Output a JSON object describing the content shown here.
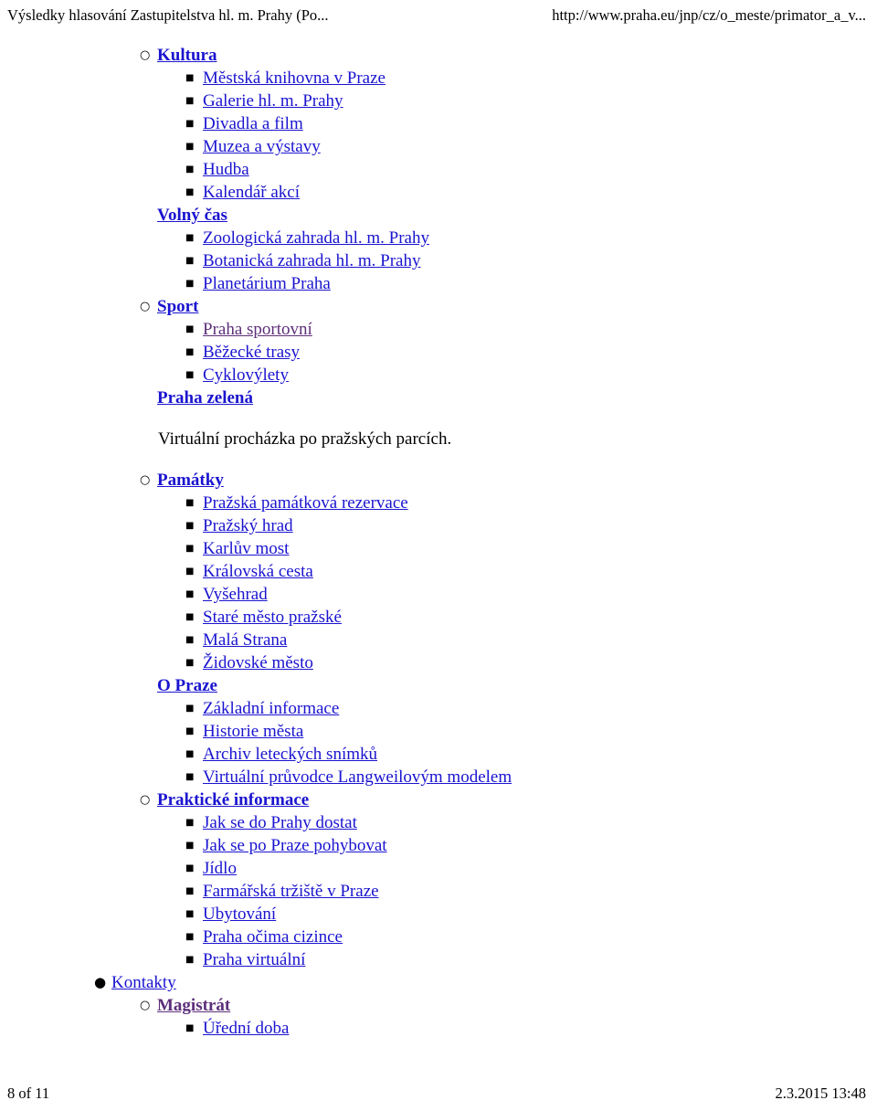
{
  "header": {
    "title": "Výsledky hlasování Zastupitelstva hl. m. Prahy (Po...",
    "url": "http://www.praha.eu/jnp/cz/o_meste/primator_a_v..."
  },
  "footer": {
    "page": "8 of 11",
    "timestamp": "2.3.2015 13:48"
  },
  "colors": {
    "link": "#1a14cf",
    "visited_link": "#5d2f7a",
    "text": "#000000",
    "background": "#ffffff"
  },
  "markers": {
    "disc": "●",
    "circle": "○",
    "square": "■"
  },
  "nav": {
    "items": [
      {
        "label": "Kultura",
        "level": 2,
        "marker": "circle",
        "bold": true,
        "link": true,
        "visited": false
      },
      {
        "label": "Městská knihovna v Praze",
        "level": 3,
        "marker": "square",
        "bold": false,
        "link": true,
        "visited": false
      },
      {
        "label": "Galerie hl. m. Prahy",
        "level": 3,
        "marker": "square",
        "bold": false,
        "link": true,
        "visited": false
      },
      {
        "label": "Divadla a film",
        "level": 3,
        "marker": "square",
        "bold": false,
        "link": true,
        "visited": false
      },
      {
        "label": "Muzea a výstavy",
        "level": 3,
        "marker": "square",
        "bold": false,
        "link": true,
        "visited": false
      },
      {
        "label": "Hudba",
        "level": 3,
        "marker": "square",
        "bold": false,
        "link": true,
        "visited": false
      },
      {
        "label": "Kalendář akcí",
        "level": 3,
        "marker": "square",
        "bold": false,
        "link": true,
        "visited": false
      },
      {
        "label": "Volný čas",
        "level": 2,
        "marker": "none",
        "bold": true,
        "link": true,
        "visited": false
      },
      {
        "label": "Zoologická zahrada hl. m. Prahy",
        "level": 3,
        "marker": "square",
        "bold": false,
        "link": true,
        "visited": false
      },
      {
        "label": "Botanická zahrada hl. m. Prahy",
        "level": 3,
        "marker": "square",
        "bold": false,
        "link": true,
        "visited": false
      },
      {
        "label": "Planetárium Praha",
        "level": 3,
        "marker": "square",
        "bold": false,
        "link": true,
        "visited": false
      },
      {
        "label": "Sport",
        "level": 2,
        "marker": "circle",
        "bold": true,
        "link": true,
        "visited": false
      },
      {
        "label": "Praha sportovní",
        "level": 3,
        "marker": "square",
        "bold": false,
        "link": true,
        "visited": true
      },
      {
        "label": "Běžecké trasy",
        "level": 3,
        "marker": "square",
        "bold": false,
        "link": true,
        "visited": false
      },
      {
        "label": "Cyklovýlety",
        "level": 3,
        "marker": "square",
        "bold": false,
        "link": true,
        "visited": false
      },
      {
        "label": "Praha zelená",
        "level": 2,
        "marker": "none",
        "bold": true,
        "link": true,
        "visited": false
      }
    ],
    "paragraph": "Virtuální procházka po pražských parcích.",
    "items2": [
      {
        "label": "Památky",
        "level": 2,
        "marker": "circle",
        "bold": true,
        "link": true,
        "visited": false
      },
      {
        "label": "Pražská památková rezervace",
        "level": 3,
        "marker": "square",
        "bold": false,
        "link": true,
        "visited": false
      },
      {
        "label": "Pražský hrad",
        "level": 3,
        "marker": "square",
        "bold": false,
        "link": true,
        "visited": false
      },
      {
        "label": "Karlův most",
        "level": 3,
        "marker": "square",
        "bold": false,
        "link": true,
        "visited": false
      },
      {
        "label": "Královská cesta",
        "level": 3,
        "marker": "square",
        "bold": false,
        "link": true,
        "visited": false
      },
      {
        "label": "Vyšehrad",
        "level": 3,
        "marker": "square",
        "bold": false,
        "link": true,
        "visited": false
      },
      {
        "label": "Staré město pražské",
        "level": 3,
        "marker": "square",
        "bold": false,
        "link": true,
        "visited": false
      },
      {
        "label": "Malá Strana",
        "level": 3,
        "marker": "square",
        "bold": false,
        "link": true,
        "visited": false
      },
      {
        "label": "Židovské město",
        "level": 3,
        "marker": "square",
        "bold": false,
        "link": true,
        "visited": false
      },
      {
        "label": "O Praze",
        "level": 2,
        "marker": "none",
        "bold": true,
        "link": true,
        "visited": false
      },
      {
        "label": "Základní informace",
        "level": 3,
        "marker": "square",
        "bold": false,
        "link": true,
        "visited": false
      },
      {
        "label": "Historie města",
        "level": 3,
        "marker": "square",
        "bold": false,
        "link": true,
        "visited": false
      },
      {
        "label": "Archiv leteckých snímků",
        "level": 3,
        "marker": "square",
        "bold": false,
        "link": true,
        "visited": false
      },
      {
        "label": "Virtuální průvodce Langweilovým modelem",
        "level": 3,
        "marker": "square",
        "bold": false,
        "link": true,
        "visited": false
      },
      {
        "label": "Praktické informace",
        "level": 2,
        "marker": "circle",
        "bold": true,
        "link": true,
        "visited": false
      },
      {
        "label": "Jak se do Prahy dostat",
        "level": 3,
        "marker": "square",
        "bold": false,
        "link": true,
        "visited": false
      },
      {
        "label": "Jak se po Praze pohybovat",
        "level": 3,
        "marker": "square",
        "bold": false,
        "link": true,
        "visited": false
      },
      {
        "label": "Jídlo",
        "level": 3,
        "marker": "square",
        "bold": false,
        "link": true,
        "visited": false
      },
      {
        "label": "Farmářská tržiště v Praze",
        "level": 3,
        "marker": "square",
        "bold": false,
        "link": true,
        "visited": false
      },
      {
        "label": "Ubytování",
        "level": 3,
        "marker": "square",
        "bold": false,
        "link": true,
        "visited": false
      },
      {
        "label": "Praha očima cizince",
        "level": 3,
        "marker": "square",
        "bold": false,
        "link": true,
        "visited": false
      },
      {
        "label": "Praha virtuální",
        "level": 3,
        "marker": "square",
        "bold": false,
        "link": true,
        "visited": false
      },
      {
        "label": "Kontakty",
        "level": 1,
        "marker": "disc",
        "bold": false,
        "link": true,
        "visited": false
      },
      {
        "label": "Magistrát",
        "level": 2,
        "marker": "circle",
        "bold": true,
        "link": true,
        "visited": true
      },
      {
        "label": "Úřední doba",
        "level": 3,
        "marker": "square",
        "bold": false,
        "link": true,
        "visited": false
      }
    ]
  }
}
